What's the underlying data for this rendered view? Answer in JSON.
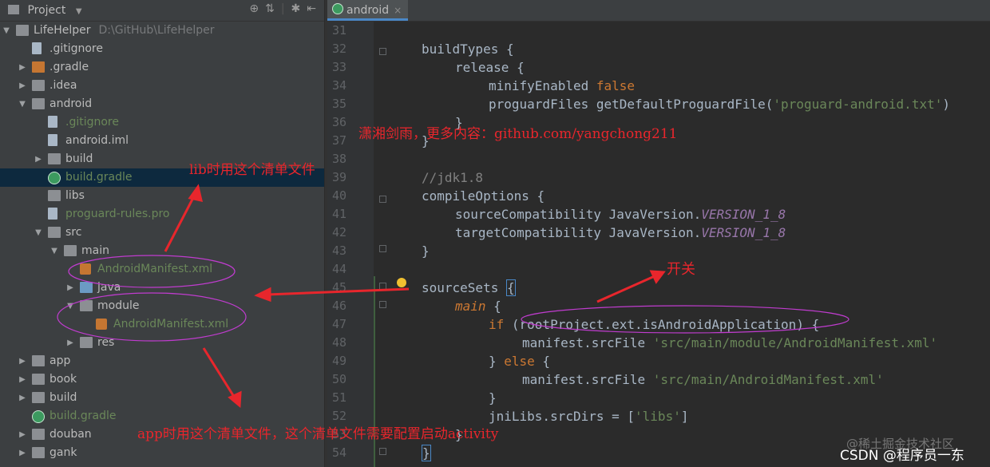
{
  "project_panel": {
    "title": "Project",
    "tools": [
      "target-icon",
      "collapse-icon",
      "gear-icon",
      "hide-icon"
    ]
  },
  "tree": [
    {
      "label": "LifeHelper",
      "hint": "D:\\GitHub\\LifeHelper",
      "icon": "module-folder-icon",
      "depth": 0,
      "arrow": "down"
    },
    {
      "label": ".gitignore",
      "icon": "file-icon",
      "depth": 1,
      "arrow": "none"
    },
    {
      "label": ".gradle",
      "icon": "folder-orange-icon",
      "depth": 1,
      "arrow": "right"
    },
    {
      "label": ".idea",
      "icon": "folder-icon",
      "depth": 1,
      "arrow": "right"
    },
    {
      "label": "android",
      "icon": "module-folder-icon",
      "depth": 1,
      "arrow": "down"
    },
    {
      "label": ".gitignore",
      "icon": "file-icon",
      "depth": 2,
      "arrow": "none",
      "color": "green"
    },
    {
      "label": "android.iml",
      "icon": "iml-icon",
      "depth": 2,
      "arrow": "none"
    },
    {
      "label": "build",
      "icon": "folder-icon",
      "depth": 2,
      "arrow": "right"
    },
    {
      "label": "build.gradle",
      "icon": "gradle-icon",
      "depth": 2,
      "arrow": "none",
      "selected": true,
      "color": "green"
    },
    {
      "label": "libs",
      "icon": "folder-icon",
      "depth": 2,
      "arrow": "none"
    },
    {
      "label": "proguard-rules.pro",
      "icon": "file-icon",
      "depth": 2,
      "arrow": "none",
      "color": "green"
    },
    {
      "label": "src",
      "icon": "folder-icon",
      "depth": 2,
      "arrow": "down"
    },
    {
      "label": "main",
      "icon": "folder-icon",
      "depth": 3,
      "arrow": "down"
    },
    {
      "label": "AndroidManifest.xml",
      "icon": "manifest-icon",
      "depth": 4,
      "arrow": "none",
      "color": "green"
    },
    {
      "label": "java",
      "icon": "folder-blue-icon",
      "depth": 4,
      "arrow": "right"
    },
    {
      "label": "module",
      "icon": "folder-icon",
      "depth": 4,
      "arrow": "down"
    },
    {
      "label": "AndroidManifest.xml",
      "icon": "manifest-icon",
      "depth": 5,
      "arrow": "none",
      "color": "green"
    },
    {
      "label": "res",
      "icon": "folder-icon",
      "depth": 4,
      "arrow": "right"
    },
    {
      "label": "app",
      "icon": "module-folder-icon",
      "depth": 1,
      "arrow": "right"
    },
    {
      "label": "book",
      "icon": "module-folder-icon",
      "depth": 1,
      "arrow": "right"
    },
    {
      "label": "build",
      "icon": "folder-icon",
      "depth": 1,
      "arrow": "right"
    },
    {
      "label": "build.gradle",
      "icon": "gradle-icon",
      "depth": 1,
      "arrow": "none",
      "color": "green"
    },
    {
      "label": "douban",
      "icon": "module-folder-icon",
      "depth": 1,
      "arrow": "right"
    },
    {
      "label": "gank",
      "icon": "module-folder-icon",
      "depth": 1,
      "arrow": "right"
    }
  ],
  "editor": {
    "tab_label": "android",
    "tab_close": "×",
    "line_numbers": [
      "31",
      "32",
      "33",
      "34",
      "35",
      "36",
      "37",
      "38",
      "39",
      "40",
      "41",
      "42",
      "43",
      "44",
      "45",
      "46",
      "47",
      "48",
      "49",
      "50",
      "51",
      "52",
      "53",
      "54"
    ]
  },
  "code": {
    "l32": "buildTypes {",
    "l33": "release {",
    "l34_a": "minifyEnabled ",
    "l34_b": "false",
    "l35_a": "proguardFiles getDefaultProguardFile(",
    "l35_b": "'proguard-android.txt'",
    "l35_c": ")",
    "l36": "}",
    "l37": "}",
    "l39": "//jdk1.8",
    "l40": "compileOptions {",
    "l41_a": "sourceCompatibility JavaVersion.",
    "l41_b": "VERSION_1_8",
    "l42_a": "targetCompatibility JavaVersion.",
    "l42_b": "VERSION_1_8",
    "l43": "}",
    "l45_a": "sourceSets ",
    "l45_b": "{",
    "l46_a": "main",
    "l46_b": " {",
    "l47_a": "if",
    "l47_b": " (rootProject.ext.isAndroidApplication) {",
    "l48_a": "manifest.srcFile ",
    "l48_b": "'src/main/module/AndroidManifest.xml'",
    "l49_a": "} ",
    "l49_b": "else",
    "l49_c": " {",
    "l50_a": "manifest.srcFile ",
    "l50_b": "'src/main/AndroidManifest.xml'",
    "l51": "}",
    "l52_a": "jniLibs.srcDirs = [",
    "l52_b": "'libs'",
    "l52_c": "]",
    "l53": "}",
    "l54": "}"
  },
  "annotations": {
    "top_note": "潇湘剑雨，更多内容：github.com/yangchong211",
    "lib_note": "lib时用这个清单文件",
    "switch_note": "开关",
    "app_note": "app时用这个清单文件，这个清单文件需要配置启动activity"
  },
  "watermarks": {
    "juejin": "@稀土掘金技术社区",
    "csdn": "CSDN @程序员一东"
  },
  "colors": {
    "annotation_red": "#e8262c",
    "circle_magenta": "#c03ccf",
    "keyword": "#cc7832",
    "string": "#6a8759",
    "constant": "#9876aa"
  }
}
